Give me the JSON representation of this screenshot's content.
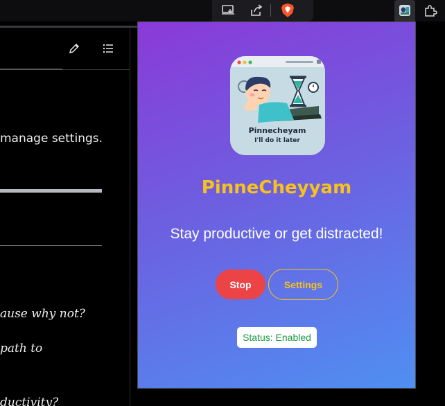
{
  "toolbar": {
    "icons": [
      "install-app-icon",
      "share-icon",
      "brave-shields-icon",
      "extension-pinecheyyam-icon",
      "extensions-puzzle-icon"
    ]
  },
  "page": {
    "lines": [
      "manage settings.",
      "ause why not?",
      " path to",
      "ductivity?"
    ]
  },
  "popup": {
    "logo": {
      "title": "Pinnecheyam",
      "subtitle": "I'll do it later"
    },
    "title": "PinneCheyyam",
    "tagline": "Stay productive or get distracted!",
    "stop_label": "Stop",
    "settings_label": "Settings",
    "status": "Status: Enabled"
  },
  "colors": {
    "gradient_start": "#8a3ad8",
    "gradient_end": "#4f8ff2",
    "title": "#f6c21b",
    "stop": "#ec4346",
    "status_text": "#1a9a42"
  }
}
